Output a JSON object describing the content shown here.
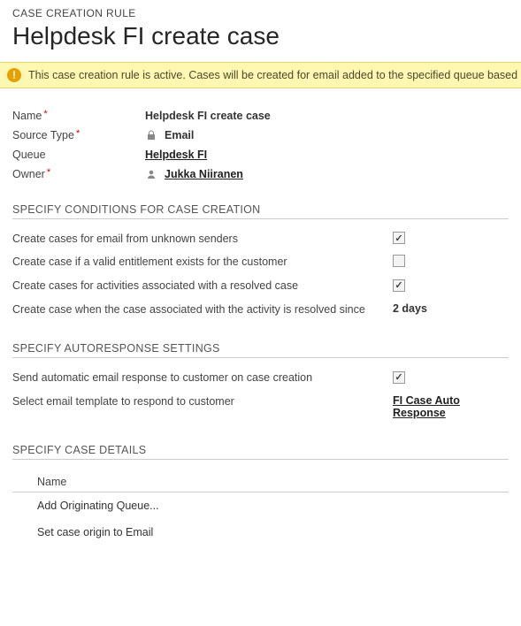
{
  "header": {
    "breadcrumb": "CASE CREATION RULE",
    "title": "Helpdesk FI create case"
  },
  "alert": {
    "text": "This case creation rule is active. Cases will be created for email added to the specified queue based on the"
  },
  "summary": {
    "name_label": "Name",
    "name_value": "Helpdesk FI create case",
    "source_label": "Source Type",
    "source_value": "Email",
    "queue_label": "Queue",
    "queue_value": "Helpdesk FI",
    "owner_label": "Owner",
    "owner_value": "Jukka Niiranen"
  },
  "sections": {
    "conditions": {
      "heading": "SPECIFY CONDITIONS FOR CASE CREATION",
      "unknown_senders_label": "Create cases for email from unknown senders",
      "unknown_senders_checked": true,
      "entitlement_label": "Create case if a valid entitlement exists for the customer",
      "entitlement_checked": false,
      "resolved_activities_label": "Create cases for activities associated with a resolved case",
      "resolved_activities_checked": true,
      "resolved_since_label": "Create case when the case associated with the activity is resolved since",
      "resolved_since_value": "2 days"
    },
    "autoresponse": {
      "heading": "SPECIFY AUTORESPONSE SETTINGS",
      "send_auto_label": "Send automatic email response to customer on case creation",
      "send_auto_checked": true,
      "template_label": "Select email template to respond to customer",
      "template_value": "FI Case Auto Response"
    },
    "details": {
      "heading": "SPECIFY CASE DETAILS",
      "name_col": "Name",
      "rows": [
        {
          "label": "Add Originating Queue..."
        },
        {
          "label": "Set case origin to Email"
        }
      ]
    }
  }
}
